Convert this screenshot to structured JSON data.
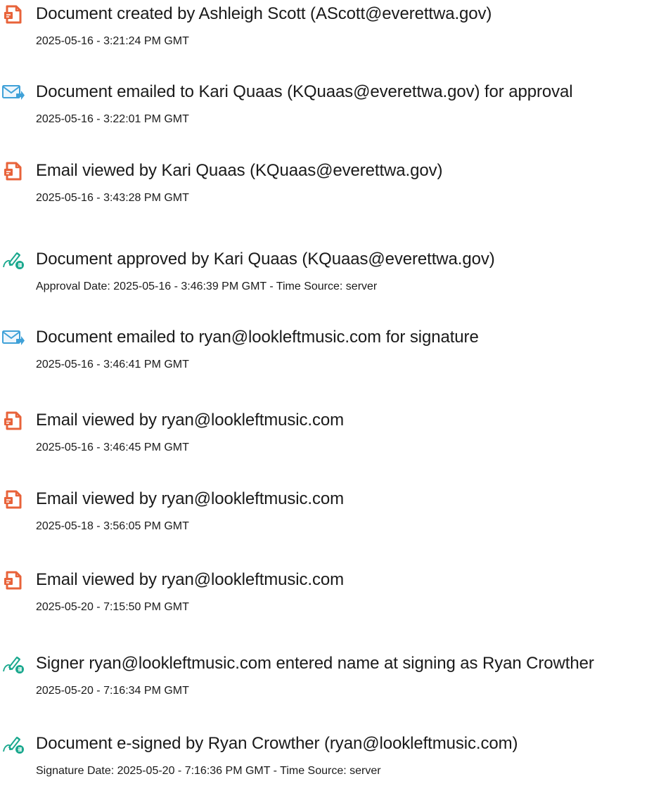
{
  "events": [
    {
      "icon": "document-created-icon",
      "title": "Document created by Ashleigh Scott (AScott@everettwa.gov)",
      "detail": "2025-05-16 - 3:21:24 PM GMT"
    },
    {
      "icon": "email-sent-icon",
      "title": "Document emailed to Kari Quaas (KQuaas@everettwa.gov) for approval",
      "detail": "2025-05-16 - 3:22:01 PM GMT"
    },
    {
      "icon": "document-viewed-icon",
      "title": "Email viewed by Kari Quaas (KQuaas@everettwa.gov)",
      "detail": "2025-05-16 - 3:43:28 PM GMT"
    },
    {
      "icon": "esign-icon",
      "title": "Document approved by Kari Quaas (KQuaas@everettwa.gov)",
      "detail": "Approval Date: 2025-05-16 - 3:46:39 PM GMT - Time Source: server"
    },
    {
      "icon": "email-sent-icon",
      "title": "Document emailed to ryan@lookleftmusic.com for signature",
      "detail": "2025-05-16 - 3:46:41 PM GMT"
    },
    {
      "icon": "document-viewed-icon",
      "title": "Email viewed by ryan@lookleftmusic.com",
      "detail": "2025-05-16 - 3:46:45 PM GMT"
    },
    {
      "icon": "document-viewed-icon",
      "title": "Email viewed by ryan@lookleftmusic.com",
      "detail": "2025-05-18 - 3:56:05 PM GMT"
    },
    {
      "icon": "document-viewed-icon",
      "title": "Email viewed by ryan@lookleftmusic.com",
      "detail": "2025-05-20 - 7:15:50 PM GMT"
    },
    {
      "icon": "esign-icon",
      "title": "Signer ryan@lookleftmusic.com entered name at signing as Ryan Crowther",
      "detail": "2025-05-20 - 7:16:34 PM GMT"
    },
    {
      "icon": "esign-icon",
      "title": "Document e-signed by Ryan Crowther (ryan@lookleftmusic.com)",
      "detail": "Signature Date: 2025-05-20 - 7:16:36 PM GMT - Time Source: server"
    }
  ],
  "colors": {
    "document_icon": "#e8633a",
    "email_icon_blue": "#3fa1d8",
    "email_icon_border": "#7b8794",
    "esign_icon_teal": "#1aa88e",
    "text": "#1a1a1a"
  }
}
